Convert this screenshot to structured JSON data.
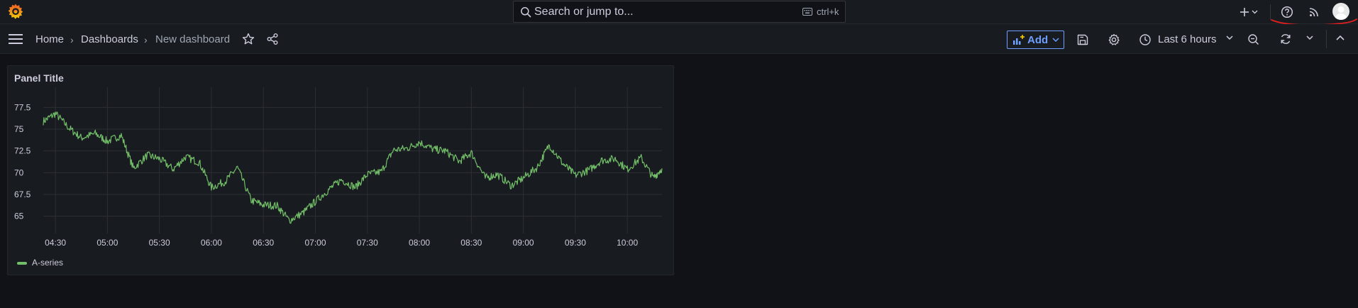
{
  "topbar": {
    "search": {
      "placeholder": "Search or jump to...",
      "shortcut": "ctrl+k"
    },
    "icons": [
      "grafana-logo-icon",
      "plus-icon",
      "chevron-down-icon",
      "help-icon",
      "news-feed-icon",
      "user-avatar"
    ]
  },
  "navbar": {
    "breadcrumbs": [
      "Home",
      "Dashboards",
      "New dashboard"
    ],
    "add_label": "Add",
    "time_range_label": "Last 6 hours"
  },
  "panel": {
    "title": "Panel Title"
  },
  "chart_data": {
    "type": "line",
    "title": "Panel Title",
    "xlabel": "",
    "ylabel": "",
    "ylim": [
      63.5,
      79
    ],
    "y_ticks": [
      "77.5",
      "75",
      "72.5",
      "70",
      "67.5",
      "65"
    ],
    "x_ticks": [
      "04:30",
      "05:00",
      "05:30",
      "06:00",
      "06:30",
      "07:00",
      "07:30",
      "08:00",
      "08:30",
      "09:00",
      "09:30",
      "10:00"
    ],
    "grid": true,
    "legend_placement": "bottom-left",
    "series": [
      {
        "name": "A-series",
        "color": "#73bf69",
        "x": [
          "04:23",
          "04:30",
          "04:38",
          "04:45",
          "04:53",
          "05:00",
          "05:08",
          "05:15",
          "05:23",
          "05:30",
          "05:38",
          "05:45",
          "05:53",
          "06:00",
          "06:08",
          "06:15",
          "06:23",
          "06:30",
          "06:38",
          "06:45",
          "06:53",
          "07:00",
          "07:08",
          "07:15",
          "07:23",
          "07:30",
          "07:38",
          "07:45",
          "07:53",
          "08:00",
          "08:08",
          "08:15",
          "08:23",
          "08:30",
          "08:38",
          "08:45",
          "08:53",
          "09:00",
          "09:08",
          "09:15",
          "09:23",
          "09:30",
          "09:38",
          "09:45",
          "09:53",
          "10:00",
          "10:08",
          "10:15",
          "10:20"
        ],
        "values": [
          75.9,
          76.8,
          75.1,
          74.0,
          74.5,
          73.6,
          74.3,
          70.5,
          72.0,
          71.6,
          70.4,
          71.8,
          71.2,
          68.3,
          69.0,
          70.6,
          66.8,
          66.3,
          66.2,
          64.5,
          65.4,
          66.7,
          68.1,
          69.2,
          68.3,
          69.8,
          70.1,
          72.6,
          72.8,
          73.5,
          72.7,
          72.5,
          71.3,
          72.3,
          69.4,
          69.8,
          68.5,
          69.4,
          70.6,
          73.2,
          71.0,
          69.7,
          70.3,
          71.4,
          71.6,
          70.4,
          71.7,
          69.4,
          70.5
        ]
      }
    ]
  }
}
